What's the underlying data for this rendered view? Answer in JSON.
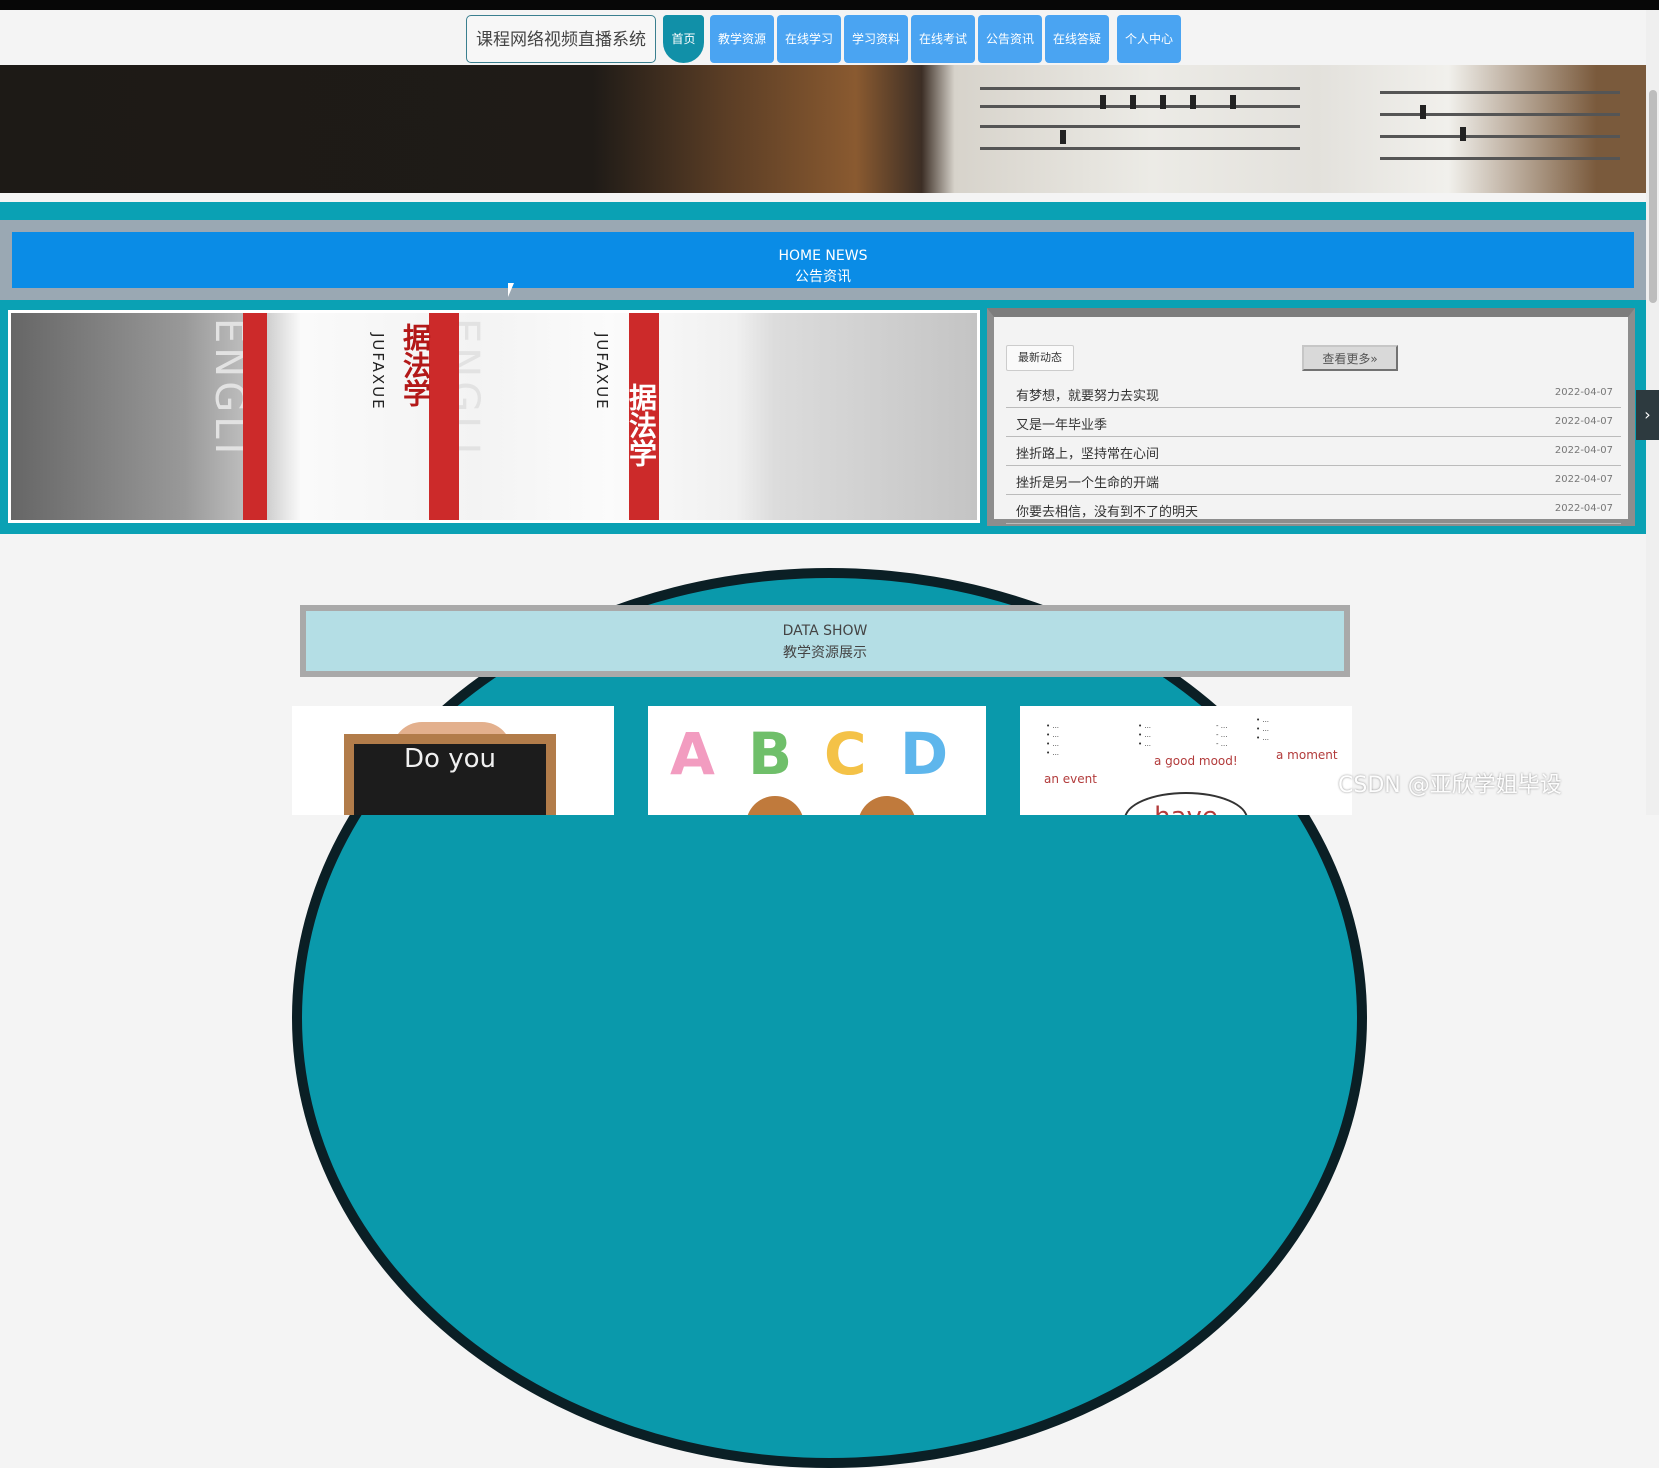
{
  "nav": {
    "brand": "课程网络视频直播系统",
    "items": [
      {
        "label": "首页",
        "active": true
      },
      {
        "label": "教学资源"
      },
      {
        "label": "在线学习"
      },
      {
        "label": "学习资料"
      },
      {
        "label": "在线考试"
      },
      {
        "label": "公告资讯"
      },
      {
        "label": "在线答疑"
      },
      {
        "label": "个人中心"
      }
    ]
  },
  "news": {
    "title_en": "HOME NEWS",
    "title_cn": "公告资讯",
    "latest_label": "最新动态",
    "more_label": "查看更多»",
    "items": [
      {
        "title": "有梦想，就要努力去实现",
        "date": "2022-04-07"
      },
      {
        "title": "又是一年毕业季",
        "date": "2022-04-07"
      },
      {
        "title": "挫折路上，坚持常在心间",
        "date": "2022-04-07"
      },
      {
        "title": "挫折是另一个生命的开端",
        "date": "2022-04-07"
      },
      {
        "title": "你要去相信，没有到不了的明天",
        "date": "2022-04-07"
      }
    ],
    "image_text": {
      "vertical_1": "据法学",
      "vertical_2": "据法学",
      "latin_1": "JUFAXUE",
      "latin_2": "JUFAXUE",
      "big_1": "ENGLI",
      "big_2": "ENGLI"
    }
  },
  "datashow": {
    "title_en": "DATA SHOW",
    "title_cn": "教学资源展示",
    "card1_text": "Do you",
    "card2_letters": [
      "A",
      "B",
      "C",
      "D"
    ],
    "card3": {
      "center": "have",
      "phrase_1": "a good mood!",
      "phrase_2": "an event",
      "phrase_3": "a moment"
    }
  },
  "watermark": "CSDN @亚欣学姐毕设",
  "colors": {
    "teal": "#0aa1b4",
    "blue": "#0a8ce6",
    "nav_blue": "#4aa4f2"
  }
}
